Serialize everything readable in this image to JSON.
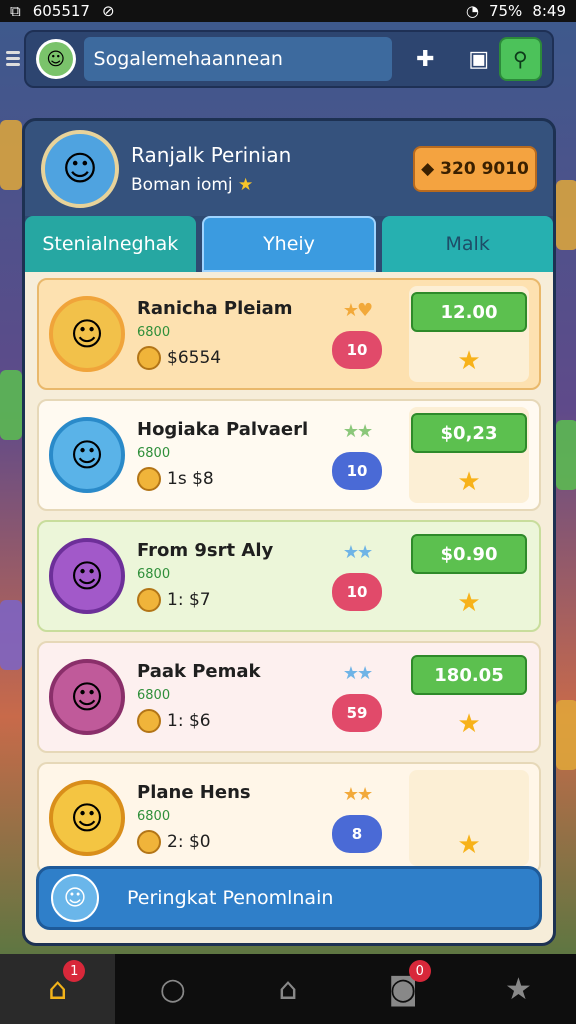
{
  "status": {
    "left_text": "605517",
    "battery": "75%",
    "time": "8:49"
  },
  "header": {
    "search_text": "Sogalemehaannean"
  },
  "profile": {
    "name": "Ranjalk Perinian",
    "subtitle": "Boman iomj",
    "coins": "320 9010"
  },
  "tabs": [
    {
      "label": "Stenialneghak"
    },
    {
      "label": "Yheiy"
    },
    {
      "label": "Malk"
    }
  ],
  "rows": [
    {
      "name": "Ranicha Pleiam",
      "sub": "6800",
      "stat": "$6554",
      "badge": "10",
      "price": "12.00"
    },
    {
      "name": "Hogiaka Palvaerl",
      "sub": "6800",
      "stat": "1s $8",
      "badge": "10",
      "price": "$0,23"
    },
    {
      "name": "From 9srt Aly",
      "sub": "6800",
      "stat": "1: $7",
      "badge": "10",
      "price": "$0.90"
    },
    {
      "name": "Paak Pemak",
      "sub": "6800",
      "stat": "1: $6",
      "badge": "59",
      "price": "180.05"
    },
    {
      "name": "Plane Hens",
      "sub": "6800",
      "stat": "2: $0",
      "badge": "8",
      "price": ""
    }
  ],
  "rank_bar": {
    "label": "Peringkat Penomlnain"
  },
  "nav": [
    {
      "icon": "home-icon",
      "badge": "1"
    },
    {
      "icon": "search-icon"
    },
    {
      "icon": "bag-icon"
    },
    {
      "icon": "camera-icon",
      "badge": "0"
    },
    {
      "icon": "star-icon"
    }
  ]
}
